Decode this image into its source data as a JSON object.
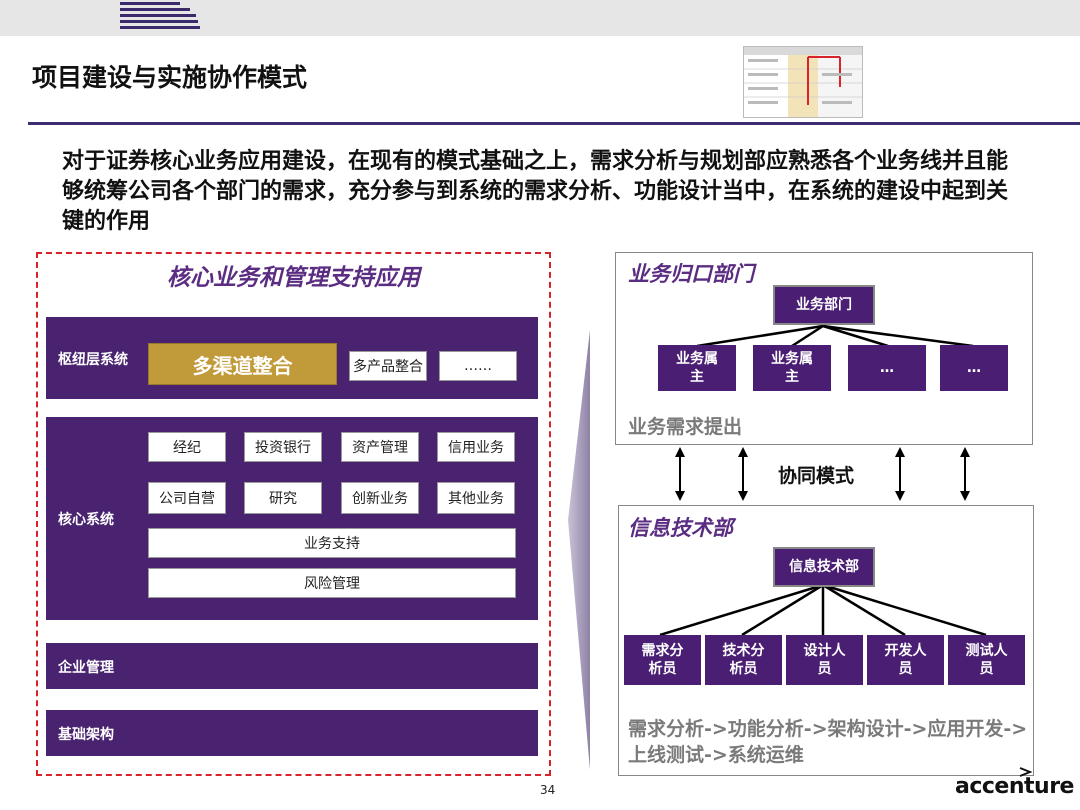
{
  "header": {
    "title": "项目建设与实施协作模式"
  },
  "intro": "对于证券核心业务应用建设，在现有的模式基础之上，需求分析与规划部应熟悉各个业务线并且能够统筹公司各个部门的需求，充分参与到系统的需求分析、功能设计当中，在系统的建设中起到关键的作用",
  "left": {
    "title": "核心业务和管理支持应用",
    "hub": {
      "label": "枢纽层系统",
      "main": "多渠道整合",
      "secondary": "多产品整合",
      "more": "……"
    },
    "core": {
      "label": "核心系统",
      "row1": [
        "经纪",
        "投资银行",
        "资产管理",
        "信用业务"
      ],
      "row2": [
        "公司自营",
        "研究",
        "创新业务",
        "其他业务"
      ],
      "support": "业务支持",
      "risk": "风险管理"
    },
    "enterprise": "企业管理",
    "infra": "基础架构"
  },
  "right": {
    "top": {
      "title": "业务归口部门",
      "root": "业务部门",
      "children": [
        "业务属主",
        "业务属主",
        "…",
        "…"
      ],
      "caption": "业务需求提出"
    },
    "collab": "协同模式",
    "bottom": {
      "title": "信息技术部",
      "root": "信息技术部",
      "children": [
        "需求分析员",
        "技术分析员",
        "设计人员",
        "开发人员",
        "测试人员"
      ],
      "caption": "需求分析->功能分析->架构设计->应用开发->上线测试->系统运维"
    }
  },
  "footer": {
    "page": "34",
    "brand": "accenture"
  }
}
